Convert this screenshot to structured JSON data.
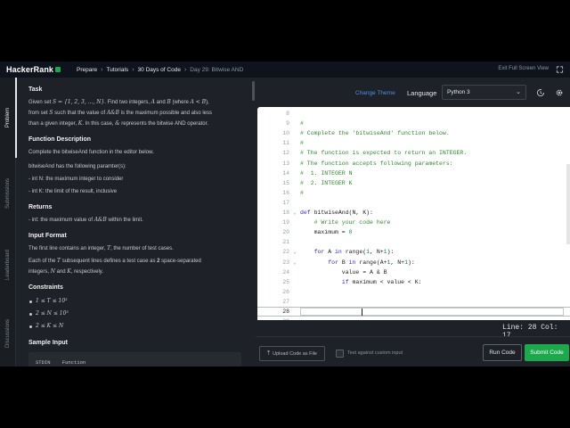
{
  "header": {
    "logo": "HackerRank",
    "breadcrumbs": [
      "Prepare",
      "Tutorials",
      "30 Days of Code",
      "Day 29: Bitwise AND"
    ],
    "exit_fullscreen": "Exit Full Screen View"
  },
  "side_tabs": [
    "Problem",
    "Submissions",
    "Leaderboard",
    "Discussions"
  ],
  "problem": {
    "task_heading": "Task",
    "task_text_1a": "Given set ",
    "task_set": "S = {1, 2, 3, ..., N}",
    "task_text_1b": ". Find two integers, ",
    "task_A": "A",
    "task_and": " and ",
    "task_B": "B",
    "task_where": " (where ",
    "task_cond": "A < B",
    "task_text_1c": "),",
    "task_text_2a": "from set ",
    "task_S": "S",
    "task_text_2b": " such that the value of ",
    "task_expr": "A&B",
    "task_text_2c": " is the maximum possible and also less",
    "task_text_3a": "than a given integer, ",
    "task_K": "K",
    "task_text_3b": ". In this case, ",
    "task_amp": "&",
    "task_text_3c": " represents the bitwise AND operator.",
    "fd_heading": "Function Description",
    "fd_text": "Complete the bitwiseAnd function in the editor below.",
    "fd_params": "bitwiseAnd has the following paramter(s):",
    "fd_p1": "- int N: the maximum integer to consider",
    "fd_p2": "- int K: the limit of the result, inclusive",
    "ret_heading": "Returns",
    "ret_text_a": "- int: the maximum value of ",
    "ret_expr": "A&B",
    "ret_text_b": " within the limit.",
    "if_heading": "Input Format",
    "if_text_1a": "The first line contains an integer, ",
    "if_T": "T",
    "if_text_1b": ", the number of test cases.",
    "if_text_2a": "Each of the ",
    "if_T2": "T",
    "if_text_2b": " subsequent lines defines a test case as ",
    "if_two": "2",
    "if_text_2c": " space-separated",
    "if_text_3a": "integers, ",
    "if_N": "N",
    "if_and": " and ",
    "if_K": "K",
    "if_text_3b": ", respectively.",
    "con_heading": "Constraints",
    "constraints": [
      "1 ≤ T ≤ 10³",
      "2 ≤ N ≤ 10³",
      "2 ≤ K ≤ N"
    ],
    "si_heading": "Sample Input",
    "si_stdin": "STDIN",
    "si_function": "Function"
  },
  "editor": {
    "change_theme": "Change Theme",
    "language_label": "Language",
    "language_value": "Python 3",
    "status": "Line: 28 Col: 17",
    "upload": "Upload Code as File",
    "test_custom": "Test against custom input",
    "run": "Run Code",
    "submit": "Submit Code",
    "lines": [
      {
        "n": "8",
        "fold": "",
        "text": ""
      },
      {
        "n": "9",
        "fold": "",
        "text": "#"
      },
      {
        "n": "10",
        "fold": "",
        "text": "# Complete the 'bitwiseAnd' function below."
      },
      {
        "n": "11",
        "fold": "",
        "text": "#"
      },
      {
        "n": "12",
        "fold": "",
        "text": "# The function is expected to return an INTEGER."
      },
      {
        "n": "13",
        "fold": "",
        "text": "# The function accepts following parameters:"
      },
      {
        "n": "14",
        "fold": "",
        "text": "#  1. INTEGER N"
      },
      {
        "n": "15",
        "fold": "",
        "text": "#  2. INTEGER K"
      },
      {
        "n": "16",
        "fold": "",
        "text": "#"
      },
      {
        "n": "17",
        "fold": "",
        "text": ""
      },
      {
        "n": "18",
        "fold": "v",
        "text": "def bitwiseAnd(N, K):"
      },
      {
        "n": "19",
        "fold": "",
        "text": "    # Write your code here"
      },
      {
        "n": "20",
        "fold": "",
        "text": "    maximum = 0"
      },
      {
        "n": "21",
        "fold": "",
        "text": ""
      },
      {
        "n": "22",
        "fold": "v",
        "text": "    for A in range(1, N+1):"
      },
      {
        "n": "23",
        "fold": "v",
        "text": "        for B in range(A+1, N+1):"
      },
      {
        "n": "24",
        "fold": "",
        "text": "            value = A & B"
      },
      {
        "n": "25",
        "fold": "",
        "text": "            if maximum < value < K:"
      },
      {
        "n": "26",
        "fold": "",
        "text": ""
      },
      {
        "n": "27",
        "fold": "",
        "text": ""
      },
      {
        "n": "28",
        "fold": "",
        "text": ""
      },
      {
        "n": "29",
        "fold": "",
        "text": ""
      }
    ]
  }
}
